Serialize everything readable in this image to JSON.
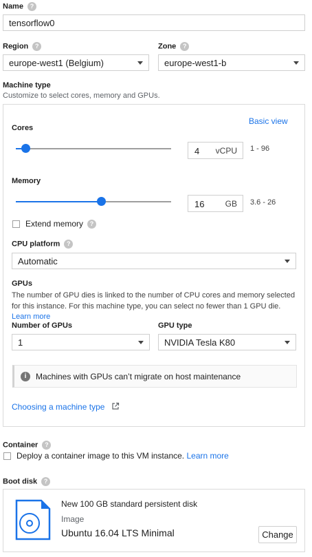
{
  "name": {
    "label": "Name",
    "value": "tensorflow0"
  },
  "region": {
    "label": "Region",
    "value": "europe-west1 (Belgium)"
  },
  "zone": {
    "label": "Zone",
    "value": "europe-west1-b"
  },
  "machine_type": {
    "label": "Machine type",
    "subtitle": "Customize to select cores, memory and GPUs.",
    "basic_view_link": "Basic view",
    "cores": {
      "label": "Cores",
      "value": "4",
      "unit": "vCPU",
      "range": "1 - 96",
      "slider_fraction": 0.0
    },
    "memory": {
      "label": "Memory",
      "value": "16",
      "unit": "GB",
      "range": "3.6 - 26",
      "slider_fraction": 0.55
    },
    "extend_memory_label": "Extend memory",
    "cpu_platform": {
      "label": "CPU platform",
      "value": "Automatic"
    },
    "gpus": {
      "label": "GPUs",
      "description": "The number of GPU dies is linked to the number of CPU cores and memory selected for this instance. For this machine type, you can select no fewer than 1 GPU die.",
      "learn_more": "Learn more",
      "number_label": "Number of GPUs",
      "number_value": "1",
      "type_label": "GPU type",
      "type_value": "NVIDIA Tesla K80"
    },
    "info_message": "Machines with GPUs can’t migrate on host maintenance",
    "choosing_link": "Choosing a machine type"
  },
  "container": {
    "label": "Container",
    "checkbox_text": "Deploy a container image to this VM instance.",
    "learn_more": "Learn more"
  },
  "boot_disk": {
    "label": "Boot disk",
    "title": "New 100 GB standard persistent disk",
    "image_label": "Image",
    "image_value": "Ubuntu 16.04 LTS Minimal",
    "change_button": "Change"
  },
  "help_glyph": "?",
  "info_glyph": "i",
  "colors": {
    "accent": "#1a73e8",
    "border": "#cfcfcf"
  }
}
